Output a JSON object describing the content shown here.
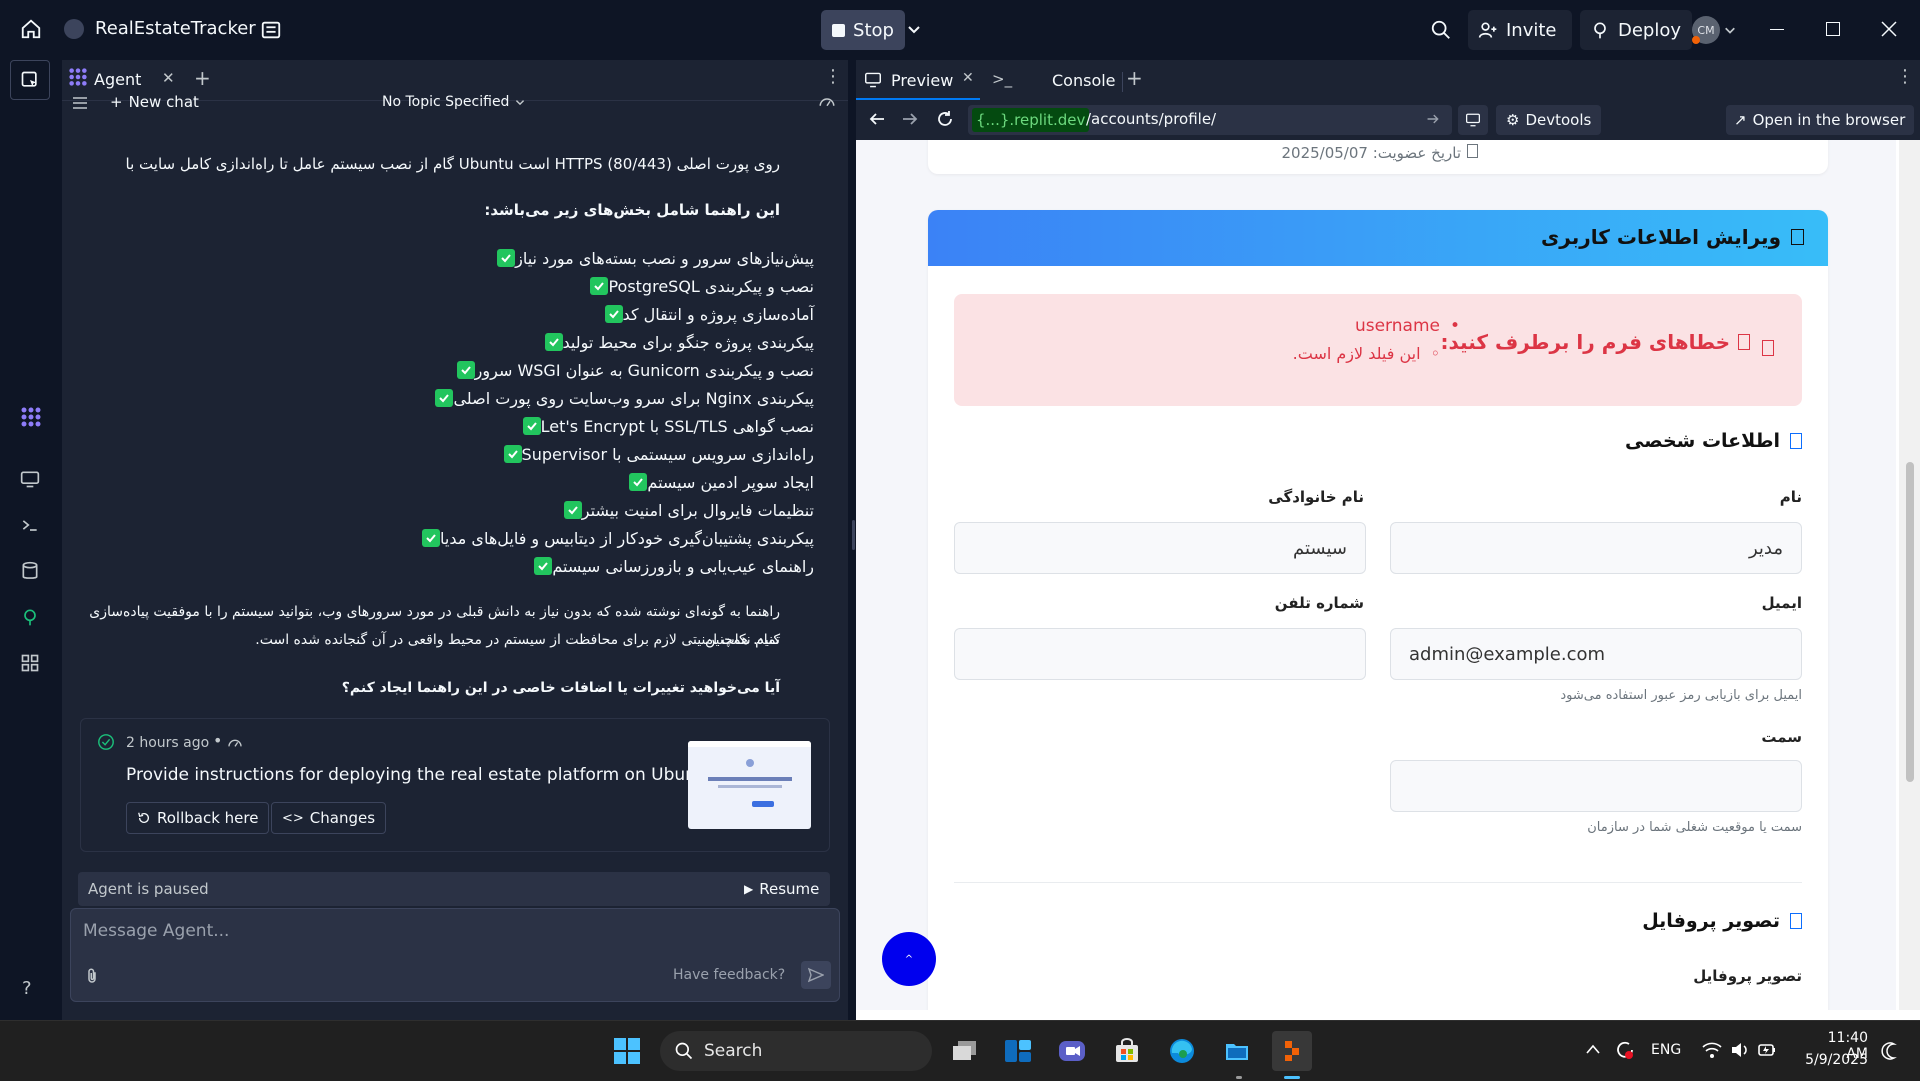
{
  "titlebar": {
    "app_name": "RealEstateTracker",
    "stop_label": "Stop",
    "invite_label": "Invite",
    "deploy_label": "Deploy",
    "avatar_initials": "CM"
  },
  "agent": {
    "tab_label": "Agent",
    "new_chat_label": "New chat",
    "topic_label": "No Topic Specified",
    "intro_line1": "روی پورت اصلی HTTPS (80/443) است Ubuntu گام از نصب سیستم عامل تا راه‌اندازی کامل سایت با",
    "intro_line2": "این راهنما شامل بخش‌های زیر می‌باشد:",
    "checklist": [
      "پیش‌نیازهای سرور و نصب بسته‌های مورد نیاز",
      "نصب و پیکربندی PostgreSQL",
      "آماده‌سازی پروژه و انتقال کد",
      "پیکربندی پروژه جنگو برای محیط تولید",
      "نصب و پیکربندی Gunicorn به عنوان WSGI سرور",
      "پیکربندی Nginx برای سرو وب‌سایت روی پورت اصلی",
      "نصب گواهی SSL/TLS با Let's Encrypt",
      "راه‌اندازی سرویس سیستمی با Supervisor",
      "ایجاد سوپر ادمین سیستم",
      "تنظیمات فایروال برای امنیت بیشتر",
      "پیکربندی پشتیبان‌گیری خودکار از دیتابیس و فایل‌های مدیا",
      "راهنمای عیب‌یابی و بازورزسانی سیستم"
    ],
    "summary_line1": "راهنما به گونه‌ای نوشته شده که بدون نیاز به دانش قبلی در مورد سرورهای وب، بتوانید سیستم را با موفقیت پیاده‌سازی کنید. همچنین",
    "summary_line2": "تمام نکات امنیتی لازم برای محافظت از سیستم در محیط واقعی در آن گنجانده شده است.",
    "question": "آیا می‌خواهید تغییرات یا اضافات خاصی در این راهنما ایجاد کنم؟",
    "checkpoint": {
      "time": "2 hours ago",
      "title": "Provide instructions for deploying the real estate platform on Ubuntu",
      "rollback_label": "Rollback here",
      "changes_label": "Changes"
    },
    "paused_label": "Agent is paused",
    "resume_label": "Resume",
    "message_placeholder": "Message Agent...",
    "feedback_label": "Have feedback?"
  },
  "preview": {
    "tab_preview": "Preview",
    "tab_console": "Console",
    "domain": ".replit.dev",
    "domain_prefix": "{...}",
    "path": "/accounts/profile/",
    "devtools_label": "Devtools",
    "open_browser_label": "Open in the browser"
  },
  "page": {
    "member_since": "تاریخ عضویت: 2025/05/07",
    "edit_header": "ویرایش اطلاعات کاربری",
    "error_title": "خطاهای فرم را برطرف کنید:",
    "error_field": "username",
    "error_msg": "این فیلد لازم است.",
    "section_personal": "اطلاعات شخصی",
    "first_name_label": "نام",
    "first_name_value": "مدیر",
    "last_name_label": "نام خانوادگی",
    "last_name_value": "سیستم",
    "email_label": "ایمیل",
    "email_value": "admin@example.com",
    "email_hint": "ایمیل برای بازیابی رمز عبور استفاده می‌شود",
    "phone_label": "شماره تلفن",
    "phone_value": "",
    "position_label": "سمت",
    "position_value": "",
    "position_hint": "سمت یا موقعیت شغلی شما در سازمان",
    "section_avatar": "تصویر پروفایل",
    "avatar_label": "تصویر پروفایل"
  },
  "taskbar": {
    "search_label": "Search",
    "lang": "ENG",
    "time": "11:40 AM",
    "date": "5/9/2025"
  },
  "colors": {
    "accent_blue": "#0079f2",
    "check_green": "#22c55e",
    "error_red": "#dc3545",
    "header_gradient_start": "#3b82f6",
    "header_gradient_end": "#38bdf8"
  }
}
